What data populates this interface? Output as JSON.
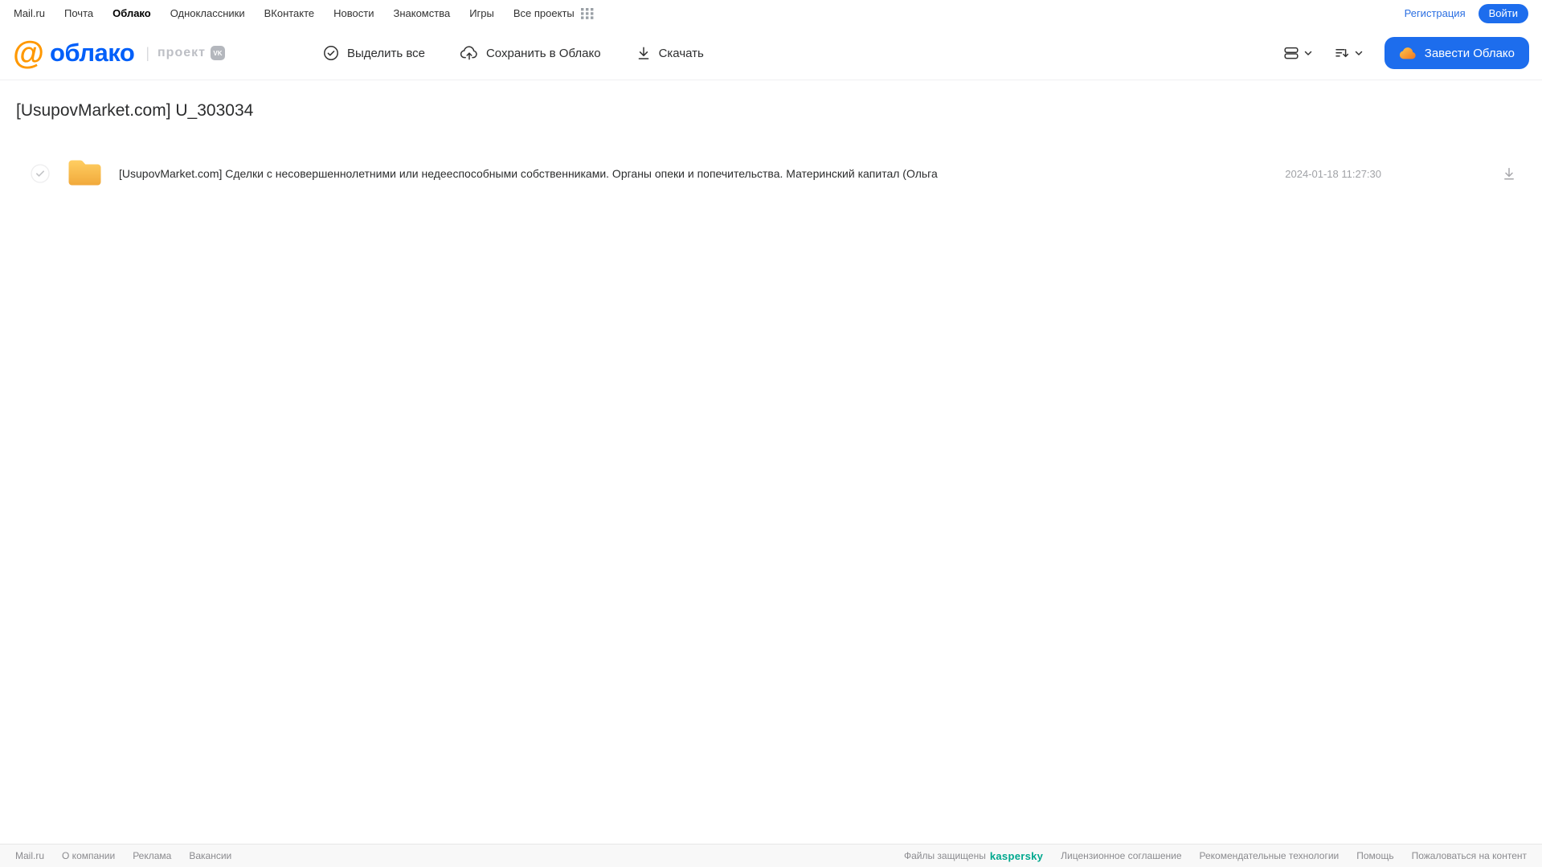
{
  "top_nav": {
    "items": [
      "Mail.ru",
      "Почта",
      "Облако",
      "Одноклассники",
      "ВКонтакте",
      "Новости",
      "Знакомства",
      "Игры",
      "Все проекты"
    ],
    "active_item": "Облако",
    "registration_label": "Регистрация",
    "login_label": "Войти"
  },
  "header": {
    "logo_at": "@",
    "logo_text": "облако",
    "project_label": "проект",
    "vk_badge": "VK",
    "toolbar": {
      "select_all_label": "Выделить все",
      "save_to_cloud_label": "Сохранить в Облако",
      "download_label": "Скачать"
    },
    "create_cloud_label": "Завести Облако"
  },
  "main": {
    "title": "[UsupovMarket.com] U_303034",
    "files": [
      {
        "type": "folder",
        "name": "[UsupovMarket.com] Сделки с несовершеннолетними или недееспособными собственниками. Органы опеки и попечительства. Материнский капитал (Ольга",
        "date": "2024-01-18 11:27:30"
      }
    ]
  },
  "footer": {
    "left_links": [
      "Mail.ru",
      "О компании",
      "Реклама",
      "Вакансии"
    ],
    "protected_text": "Файлы защищены",
    "kaspersky_label": "kaspersky",
    "right_links": [
      "Лицензионное соглашение",
      "Рекомендательные технологии",
      "Помощь",
      "Пожаловаться на контент"
    ]
  },
  "colors": {
    "accent_blue": "#1d6ded",
    "logo_blue": "#005ff9",
    "logo_orange": "#ff9800",
    "folder_yellow": "#f7b643",
    "kaspersky_teal": "#00a88e",
    "muted_gray": "#a0a2a6"
  }
}
